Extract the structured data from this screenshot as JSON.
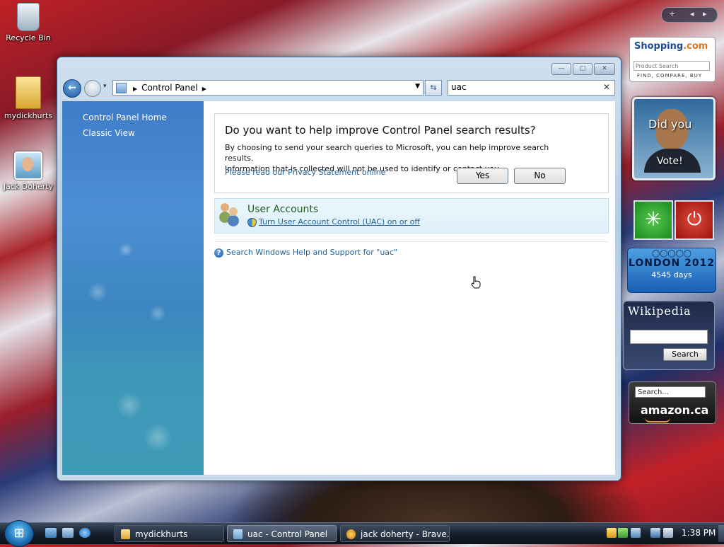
{
  "desktop": {
    "icons": [
      {
        "label": "Recycle Bin"
      },
      {
        "label": "mydickhurts"
      },
      {
        "label": "Jack Doherty"
      }
    ]
  },
  "window": {
    "caption_buttons": {
      "minimize": "—",
      "maximize": "□",
      "close": "✕"
    },
    "nav": {
      "back": "←",
      "dropdown": "▾"
    },
    "address": {
      "separator": "▶",
      "crumb": "Control Panel",
      "dropdown": "▼"
    },
    "refresh": "⇆",
    "search": {
      "value": "uac",
      "clear": "✕"
    },
    "sidebar": {
      "home": "Control Panel Home",
      "classic": "Classic View"
    },
    "feedback": {
      "question": "Do you want to help improve Control Panel search results?",
      "body_line1": "By choosing to send your search queries to Microsoft, you can help improve search results.",
      "body_line2": "Information that is collected will not be used to identify or contact you.",
      "privacy_link": "Please read our Privacy Statement online",
      "yes": "Yes",
      "no": "No"
    },
    "result": {
      "title": "User Accounts",
      "link": "Turn User Account Control (UAC) on or off"
    },
    "help": {
      "icon": "?",
      "text": "Search Windows Help and Support for \"uac\""
    }
  },
  "gadgets": {
    "sidebar_tools": {
      "add": "+",
      "prev": "◂",
      "next": "▸"
    },
    "shopping": {
      "brand": "Shopping",
      "brand_suffix": ".com",
      "placeholder": "Product Search",
      "tagline": "FIND, COMPARE, BUY"
    },
    "photo": {
      "line1": "Did you",
      "line2": "Vote!"
    },
    "green_button": "✳",
    "red_button": "⏻",
    "olympics": {
      "rings": "◯◯◯◯◯",
      "city": "LONDON 2012",
      "days": "4545 days"
    },
    "wikipedia": {
      "title": "Wikipedia",
      "button": "Search"
    },
    "amazon": {
      "placeholder": "Search...",
      "logo": "amazon.ca"
    }
  },
  "taskbar": {
    "start": "⊞",
    "tasks": [
      {
        "label": "mydickhurts",
        "active": false
      },
      {
        "label": "uac - Control Panel",
        "active": true
      },
      {
        "label": "jack doherty - Brave...",
        "active": false
      }
    ],
    "clock": "1:38 PM"
  },
  "colors": {
    "link": "#1c5f9b",
    "result_title": "#1e5c21",
    "sidebar": "#4d8fd4"
  }
}
